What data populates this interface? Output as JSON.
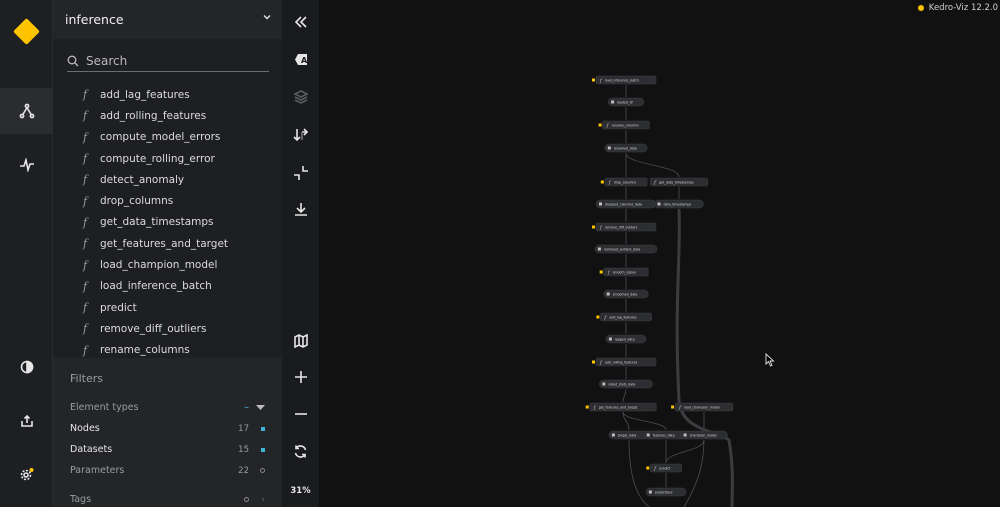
{
  "app": {
    "version": "Kedro-Viz 12.2.0"
  },
  "sidebar": {
    "pipeline": "inference",
    "search": {
      "placeholder": "Search",
      "value": ""
    },
    "nodes": [
      "add_lag_features",
      "add_rolling_features",
      "compute_model_errors",
      "compute_rolling_error",
      "detect_anomaly",
      "drop_columns",
      "get_data_timestamps",
      "get_features_and_target",
      "load_champion_model",
      "load_inference_batch",
      "predict",
      "remove_diff_outliers",
      "rename_columns"
    ],
    "node_icon": "f",
    "filters": {
      "title": "Filters",
      "element_types": "Element types",
      "rows": [
        {
          "label": "Nodes",
          "count": "17"
        },
        {
          "label": "Datasets",
          "count": "15"
        },
        {
          "label": "Parameters",
          "count": "22"
        }
      ],
      "tags": "Tags"
    }
  },
  "toolbar": {
    "zoom": "31%"
  },
  "graph": {
    "nodes": [
      {
        "id": "n1",
        "type": "task",
        "label": "load_inference_batch",
        "active": true
      },
      {
        "id": "d1",
        "type": "data",
        "label": "loaded_df"
      },
      {
        "id": "n2",
        "type": "task",
        "label": "rename_columns",
        "active": true
      },
      {
        "id": "d2",
        "type": "data",
        "label": "renamed_data"
      },
      {
        "id": "n3",
        "type": "task",
        "label": "drop_columns",
        "active": true
      },
      {
        "id": "n4",
        "type": "task",
        "label": "get_data_timestamps",
        "active": false
      },
      {
        "id": "d3",
        "type": "data",
        "label": "dropped_columns_data"
      },
      {
        "id": "d4",
        "type": "data",
        "label": "data_timestamps"
      },
      {
        "id": "n5",
        "type": "task",
        "label": "remove_diff_outliers",
        "active": true
      },
      {
        "id": "d5",
        "type": "data",
        "label": "removed_outliers_data"
      },
      {
        "id": "n6",
        "type": "task",
        "label": "smooth_signal",
        "active": true
      },
      {
        "id": "d6",
        "type": "data",
        "label": "smoothed_data"
      },
      {
        "id": "n7",
        "type": "task",
        "label": "add_lag_features",
        "active": true
      },
      {
        "id": "d7",
        "type": "data",
        "label": "lagged_data"
      },
      {
        "id": "n8",
        "type": "task",
        "label": "add_rolling_features",
        "active": true
      },
      {
        "id": "d8",
        "type": "data",
        "label": "rolled_stats_data"
      },
      {
        "id": "n9",
        "type": "task",
        "label": "get_features_and_target",
        "active": true
      },
      {
        "id": "n10",
        "type": "task",
        "label": "load_champion_model",
        "active": true
      },
      {
        "id": "d9",
        "type": "data",
        "label": "target_data"
      },
      {
        "id": "d10",
        "type": "data",
        "label": "features_data"
      },
      {
        "id": "d11",
        "type": "data",
        "label": "champion_model"
      },
      {
        "id": "n11",
        "type": "task",
        "label": "predict",
        "active": true
      },
      {
        "id": "d12",
        "type": "data",
        "label": "predictions"
      }
    ]
  },
  "colors": {
    "accent": "#ffc400",
    "filter_active": "#3fb8d6",
    "background": "#111111"
  }
}
